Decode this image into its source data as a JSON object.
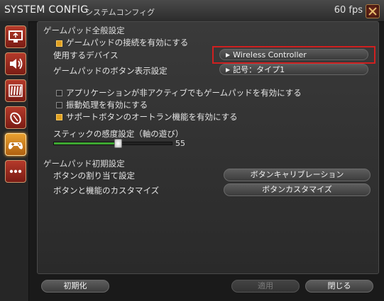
{
  "window": {
    "title": "SYSTEM CONFIG",
    "subtitle": "システムコンフィグ",
    "fps": "60 fps"
  },
  "sidebar": {
    "items": [
      {
        "name": "display",
        "icon": "monitor-icon"
      },
      {
        "name": "sound",
        "icon": "speaker-icon"
      },
      {
        "name": "other",
        "icon": "stripes-icon"
      },
      {
        "name": "mouse",
        "icon": "mouse-icon"
      },
      {
        "name": "gamepad",
        "icon": "gamepad-icon",
        "active": true
      },
      {
        "name": "more",
        "icon": "more-icon"
      }
    ]
  },
  "general": {
    "header": "ゲームパッド全般設定",
    "enable_gamepad": {
      "label": "ゲームパッドの接続を有効にする",
      "checked": true
    },
    "device": {
      "label": "使用するデバイス",
      "value": "Wireless Controller"
    },
    "button_display": {
      "label": "ゲームパッドのボタン表示設定",
      "value": "記号：タイプ1"
    },
    "inactive_enable": {
      "label": "アプリケーションが非アクティブでもゲームパッドを有効にする",
      "checked": false
    },
    "vibration": {
      "label": "振動処理を有効にする",
      "checked": false
    },
    "support_autorun": {
      "label": "サポートボタンのオートラン機能を有効にする",
      "checked": true
    },
    "stick": {
      "label": "スティックの感度設定（軸の遊び）",
      "value": "55"
    }
  },
  "initial": {
    "header": "ゲームパッド初期設定",
    "assign": {
      "label": "ボタンの割り当て設定",
      "button": "ボタンキャリブレーション"
    },
    "customize": {
      "label": "ボタンと機能のカスタマイズ",
      "button": "ボタンカスタマイズ"
    }
  },
  "footer": {
    "reset": "初期化",
    "apply": "適用",
    "close": "閉じる"
  },
  "colors": {
    "accent": "#e0a020",
    "highlight": "#d02020",
    "slider": "#3ea832"
  }
}
